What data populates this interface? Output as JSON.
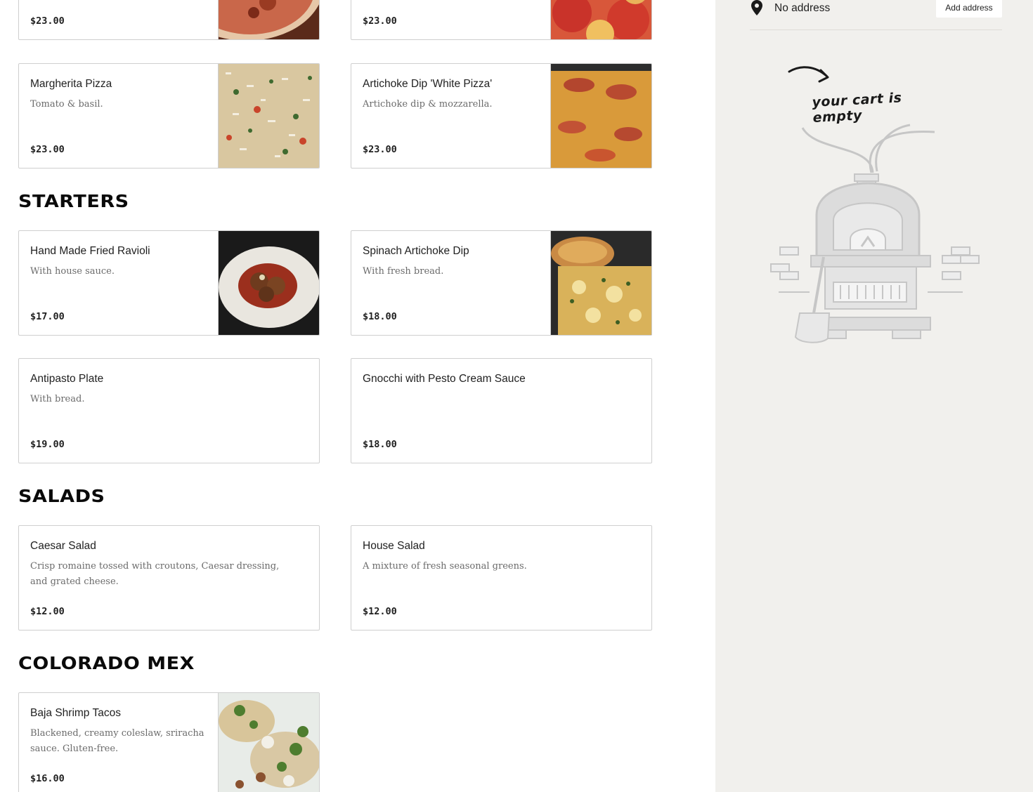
{
  "menu": {
    "pizza_partial": [
      {
        "price": "$23.00"
      },
      {
        "price": "$23.00"
      }
    ],
    "pizza": [
      {
        "title": "Margherita Pizza",
        "desc": "Tomato & basil.",
        "price": "$23.00"
      },
      {
        "title": "Artichoke Dip 'White Pizza'",
        "desc": "Artichoke dip & mozzarella.",
        "price": "$23.00"
      }
    ],
    "starters": {
      "heading": "STARTERS",
      "items": [
        {
          "title": "Hand Made Fried Ravioli",
          "desc": "With house sauce.",
          "price": "$17.00"
        },
        {
          "title": "Spinach Artichoke Dip",
          "desc": "With fresh bread.",
          "price": "$18.00"
        },
        {
          "title": "Antipasto Plate",
          "desc": "With bread.",
          "price": "$19.00"
        },
        {
          "title": "Gnocchi with Pesto Cream Sauce",
          "desc": "",
          "price": "$18.00"
        }
      ]
    },
    "salads": {
      "heading": "SALADS",
      "items": [
        {
          "title": "Caesar Salad",
          "desc": "Crisp romaine tossed with croutons, Caesar dressing, and grated cheese.",
          "price": "$12.00"
        },
        {
          "title": "House Salad",
          "desc": "A mixture of fresh seasonal greens.",
          "price": "$12.00"
        }
      ]
    },
    "colorado_mex": {
      "heading": "COLORADO MEX",
      "items": [
        {
          "title": "Baja Shrimp Tacos",
          "desc": "Blackened, creamy coleslaw, sriracha sauce. Gluten-free.",
          "price": "$16.00"
        }
      ]
    }
  },
  "sidebar": {
    "address_label": "No address",
    "add_address_button": "Add address",
    "cart_empty_text": "your cart is empty",
    "pin_icon": "location-pin-icon",
    "illustration": "pizza-oven-illustration"
  },
  "colors": {
    "sidebar_bg": "#f1f0ed",
    "card_border": "#cfcfcf",
    "text": "#1f1f1f",
    "muted": "#6b6b6b"
  }
}
